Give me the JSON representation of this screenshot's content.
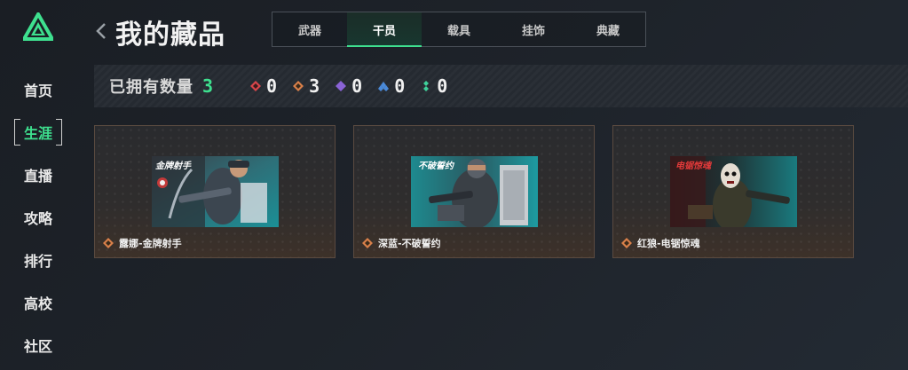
{
  "sidebar": {
    "items": [
      {
        "label": "首页",
        "active": false
      },
      {
        "label": "生涯",
        "active": true
      },
      {
        "label": "直播",
        "active": false
      },
      {
        "label": "攻略",
        "active": false
      },
      {
        "label": "排行",
        "active": false
      },
      {
        "label": "高校",
        "active": false
      },
      {
        "label": "社区",
        "active": false
      }
    ]
  },
  "header": {
    "title": "我的藏品",
    "back_icon": "chevron-left-icon"
  },
  "tabs": [
    {
      "label": "武器",
      "active": false
    },
    {
      "label": "干员",
      "active": true
    },
    {
      "label": "载具",
      "active": false
    },
    {
      "label": "挂饰",
      "active": false
    },
    {
      "label": "典藏",
      "active": false
    }
  ],
  "summary": {
    "label": "已拥有数量",
    "total": "3",
    "rarities": [
      {
        "icon": "red-diamond-icon",
        "color": "#d9454a",
        "count": "0"
      },
      {
        "icon": "orange-diamond-icon",
        "color": "#d9804a",
        "count": "3"
      },
      {
        "icon": "purple-diamond-icon",
        "color": "#8a63d6",
        "count": "0"
      },
      {
        "icon": "blue-diamond-icon",
        "color": "#4a8ad9",
        "count": "0"
      },
      {
        "icon": "green-diamond-icon",
        "color": "#3ed09a",
        "count": "0"
      }
    ]
  },
  "cards": [
    {
      "name": "露娜-金牌射手",
      "image_title": "金牌射手",
      "rarity_color": "#d9804a"
    },
    {
      "name": "深蓝-不破誓约",
      "image_title": "不破誓约",
      "rarity_color": "#d9804a"
    },
    {
      "name": "红狼-电锯惊魂",
      "image_title": "电锯惊魂",
      "rarity_color": "#d9804a"
    }
  ],
  "colors": {
    "accent": "#3ee08f",
    "background": "#1e232a"
  }
}
